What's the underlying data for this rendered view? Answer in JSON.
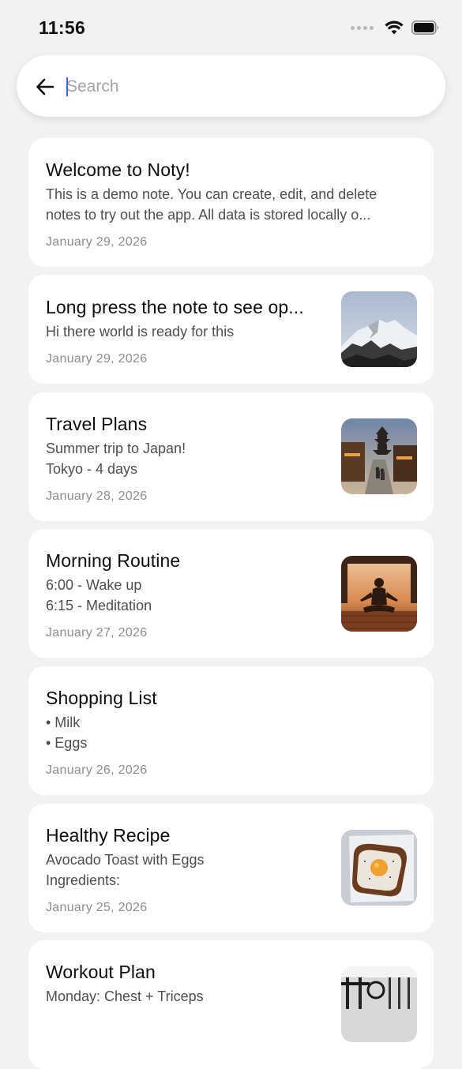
{
  "status_bar": {
    "time": "11:56"
  },
  "search": {
    "placeholder": "Search",
    "value": ""
  },
  "notes": [
    {
      "title": "Welcome to Noty!",
      "body": "This is a demo note. You can create, edit, and delete\nnotes to try out the app. All data is stored locally o...",
      "date": "January 29, 2026",
      "image": null
    },
    {
      "title": "Long press the note to see op...",
      "body": "Hi there world is ready for this",
      "date": "January 29, 2026",
      "image": "snowy-mountain"
    },
    {
      "title": "Travel Plans",
      "body": "Summer trip to Japan!\nTokyo - 4 days",
      "date": "January 28, 2026",
      "image": "japan-street-pagoda"
    },
    {
      "title": "Morning Routine",
      "body": "6:00 - Wake up\n6:15 - Meditation",
      "date": "January 27, 2026",
      "image": "meditation-silhouette"
    },
    {
      "title": "Shopping List",
      "body": "• Milk\n• Eggs",
      "date": "January 26, 2026",
      "image": null
    },
    {
      "title": "Healthy Recipe",
      "body": "Avocado Toast with Eggs\nIngredients:",
      "date": "January 25, 2026",
      "image": "egg-toast"
    },
    {
      "title": "Workout Plan",
      "body": "Monday: Chest + Triceps",
      "date": "",
      "image": "gym-equipment"
    }
  ]
}
